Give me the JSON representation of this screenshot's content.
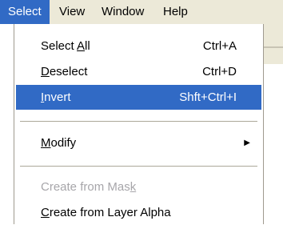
{
  "menubar": {
    "items": [
      {
        "label": "Select",
        "active": true
      },
      {
        "label": "View"
      },
      {
        "label": "Window"
      },
      {
        "label": "Help"
      }
    ]
  },
  "dropdown": {
    "items": [
      {
        "pre": "Select ",
        "mnemonic": "A",
        "post": "ll",
        "shortcut": "Ctrl+A"
      },
      {
        "pre": "",
        "mnemonic": "D",
        "post": "eselect",
        "shortcut": "Ctrl+D"
      },
      {
        "pre": "",
        "mnemonic": "I",
        "post": "nvert",
        "shortcut": "Shft+Ctrl+I",
        "selected": true
      },
      {
        "pre": "",
        "mnemonic": "M",
        "post": "odify",
        "submenu_icon": "right-triangle-icon"
      },
      {
        "pre": "Create from Mas",
        "mnemonic": "k",
        "post": "",
        "disabled": true
      },
      {
        "pre": "",
        "mnemonic": "C",
        "post": "reate from Layer Alpha"
      }
    ]
  },
  "colors": {
    "highlight": "#316ac5",
    "menubar_bg": "#ece9d8",
    "disabled_text": "#a7a6aa"
  }
}
